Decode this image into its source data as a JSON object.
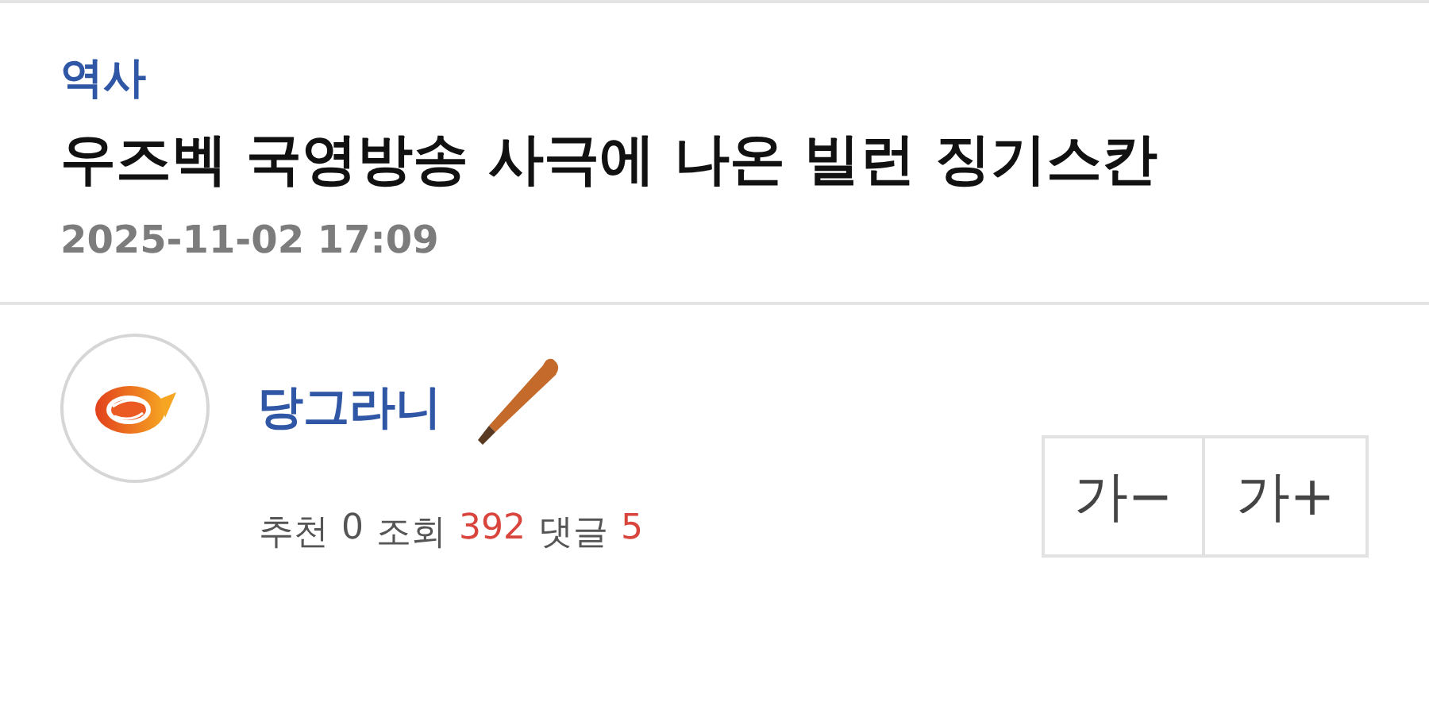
{
  "post": {
    "category": "역사",
    "title": "우즈벡 국영방송 사극에 나온 빌런 징기스칸",
    "date": "2025-11-02 17:09"
  },
  "author": {
    "name": "당그라니"
  },
  "stats": [
    {
      "label": "추천",
      "value": "0",
      "highlighted": false
    },
    {
      "label": "조회",
      "value": "392",
      "highlighted": true
    },
    {
      "label": "댓글",
      "value": "5",
      "highlighted": true
    }
  ],
  "font_buttons": [
    {
      "label": "가−"
    },
    {
      "label": "가+"
    }
  ]
}
